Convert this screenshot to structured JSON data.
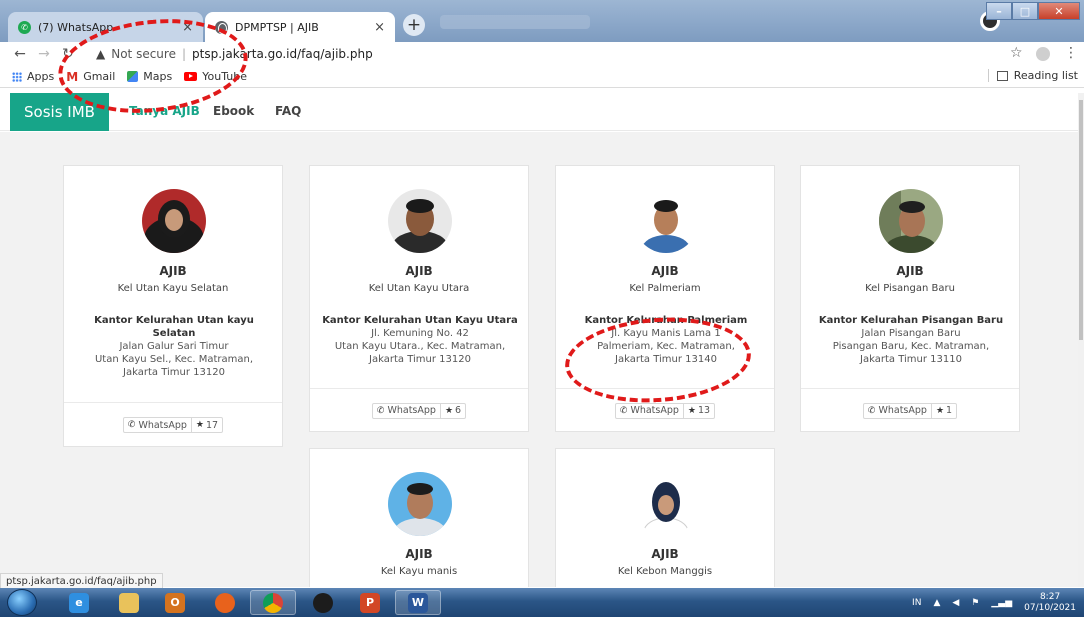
{
  "browser": {
    "tabs": [
      {
        "title": "(7) WhatsApp",
        "close": "×"
      },
      {
        "title": "DPMPTSP | AJIB",
        "close": "×"
      }
    ],
    "new_tab": "+",
    "address": {
      "security": "Not secure",
      "url": "ptsp.jakarta.go.id/faq/ajib.php"
    },
    "bookmarks": [
      {
        "label": "Apps",
        "icon": "apps-grid-icon"
      },
      {
        "label": "Gmail",
        "icon": "gmail-icon"
      },
      {
        "label": "Maps",
        "icon": "maps-icon"
      },
      {
        "label": "YouTube",
        "icon": "youtube-icon"
      }
    ],
    "reading_list": "Reading list",
    "status_url": "ptsp.jakarta.go.id/faq/ajib.php"
  },
  "site": {
    "brand": "Sosis IMB",
    "nav": [
      "Tanya AJIB",
      "Ebook",
      "FAQ"
    ],
    "accent_color": "#17a589"
  },
  "cards": [
    {
      "title": "AJIB",
      "kel": "Kel Utan Kayu Selatan",
      "office": "Kantor Kelurahan Utan kayu Selatan",
      "address": [
        "Jalan Galur Sari Timur",
        "Utan Kayu Sel., Kec. Matraman,",
        "Jakarta Timur 13120"
      ],
      "whatsapp": "WhatsApp",
      "rating": "17"
    },
    {
      "title": "AJIB",
      "kel": "Kel Utan Kayu Utara",
      "office": "Kantor Kelurahan Utan Kayu Utara",
      "address": [
        "Jl. Kemuning No. 42",
        "Utan Kayu Utara., Kec. Matraman,",
        "Jakarta Timur 13120"
      ],
      "whatsapp": "WhatsApp",
      "rating": "6"
    },
    {
      "title": "AJIB",
      "kel": "Kel Palmeriam",
      "office": "Kantor Kelurahan Palmeriam",
      "address": [
        "Jl. Kayu Manis Lama 1",
        "Palmeriam, Kec. Matraman,",
        "Jakarta Timur 13140"
      ],
      "whatsapp": "WhatsApp",
      "rating": "13"
    },
    {
      "title": "AJIB",
      "kel": "Kel Pisangan Baru",
      "office": "Kantor Kelurahan Pisangan Baru",
      "address": [
        "Jalan Pisangan Baru",
        "Pisangan Baru, Kec. Matraman,",
        "Jakarta Timur 13110"
      ],
      "whatsapp": "WhatsApp",
      "rating": "1"
    },
    {
      "title": "AJIB",
      "kel": "Kel Kayu manis"
    },
    {
      "title": "AJIB",
      "kel": "Kel Kebon Manggis"
    }
  ],
  "taskbar": {
    "apps": [
      "ie-icon",
      "explorer-icon",
      "outlook-icon",
      "firefox-icon",
      "chrome-icon",
      "chrome-alt-icon",
      "powerpoint-icon",
      "word-icon"
    ],
    "lang": "IN",
    "time": "8:27",
    "date": "07/10/2021"
  }
}
